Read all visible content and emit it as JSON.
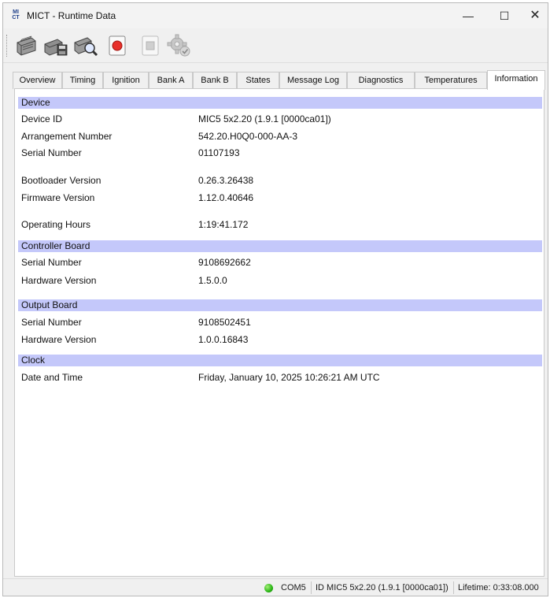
{
  "window": {
    "title": "MICT - Runtime Data",
    "app_icon_text_top": "MI",
    "app_icon_text_bottom": "CT",
    "minimize": "—",
    "maximize": "☐",
    "close": "✕"
  },
  "toolbar": {
    "icons": [
      "printer-icon",
      "save-disk-icon",
      "print-preview-icon",
      "record-icon",
      "stop-icon",
      "settings-gear-icon"
    ]
  },
  "tabs": [
    "Overview",
    "Timing",
    "Ignition",
    "Bank A",
    "Bank B",
    "States",
    "Message Log",
    "Diagnostics",
    "Temperatures",
    "Information"
  ],
  "active_tab": "Information",
  "sections": {
    "device": {
      "header": "Device",
      "rows": [
        {
          "label": "Device ID",
          "value": "MIC5 5x2.20 (1.9.1 [0000ca01])"
        },
        {
          "label": "Arrangement Number",
          "value": "542.20.H0Q0-000-AA-3"
        },
        {
          "label": "Serial Number",
          "value": "01107193"
        },
        {
          "label": "Bootloader Version",
          "value": "0.26.3.26438"
        },
        {
          "label": "Firmware Version",
          "value": "1.12.0.40646"
        },
        {
          "label": "Operating Hours",
          "value": "1:19:41.172"
        }
      ]
    },
    "controller_board": {
      "header": "Controller Board",
      "rows": [
        {
          "label": "Serial Number",
          "value": "9108692662"
        },
        {
          "label": "Hardware Version",
          "value": "1.5.0.0"
        }
      ]
    },
    "output_board": {
      "header": "Output Board",
      "rows": [
        {
          "label": "Serial Number",
          "value": "9108502451"
        },
        {
          "label": "Hardware Version",
          "value": "1.0.0.16843"
        }
      ]
    },
    "clock": {
      "header": "Clock",
      "rows": [
        {
          "label": "Date and Time",
          "value": "Friday, January 10, 2025 10:26:21 AM UTC"
        }
      ]
    }
  },
  "statusbar": {
    "port": "COM5",
    "device_id": "ID MIC5 5x2.20 (1.9.1 [0000ca01])",
    "lifetime": "Lifetime: 0:33:08.000",
    "connection_color": "#29b515"
  }
}
